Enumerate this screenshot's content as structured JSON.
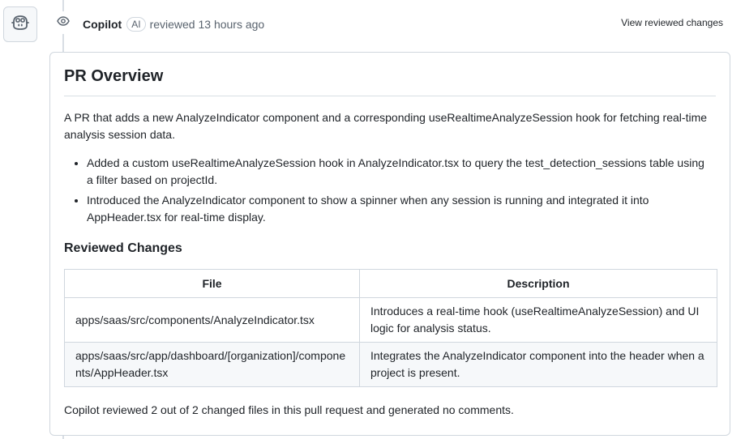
{
  "review": {
    "author": "Copilot",
    "ai_badge": "AI",
    "action": "reviewed 13 hours ago",
    "view_changes_label": "View reviewed changes"
  },
  "overview": {
    "title": "PR Overview",
    "summary": "A PR that adds a new AnalyzeIndicator component and a corresponding useRealtimeAnalyzeSession hook for fetching real-time analysis session data.",
    "bullets": [
      "Added a custom useRealtimeAnalyzeSession hook in AnalyzeIndicator.tsx to query the test_detection_sessions table using a filter based on projectId.",
      "Introduced the AnalyzeIndicator component to show a spinner when any session is running and integrated it into AppHeader.tsx for real-time display."
    ]
  },
  "reviewed_changes": {
    "title": "Reviewed Changes",
    "columns": [
      "File",
      "Description"
    ],
    "rows": [
      {
        "file": "apps/saas/src/components/AnalyzeIndicator.tsx",
        "description": "Introduces a real-time hook (useRealtimeAnalyzeSession) and UI logic for analysis status."
      },
      {
        "file": "apps/saas/src/app/dashboard/[organization]/components/AppHeader.tsx",
        "description": "Integrates the AnalyzeIndicator component into the header when a project is present."
      }
    ],
    "footer": "Copilot reviewed 2 out of 2 changed files in this pull request and generated no comments."
  },
  "icons": {
    "avatar": "copilot-icon",
    "timeline": "eye-icon"
  }
}
